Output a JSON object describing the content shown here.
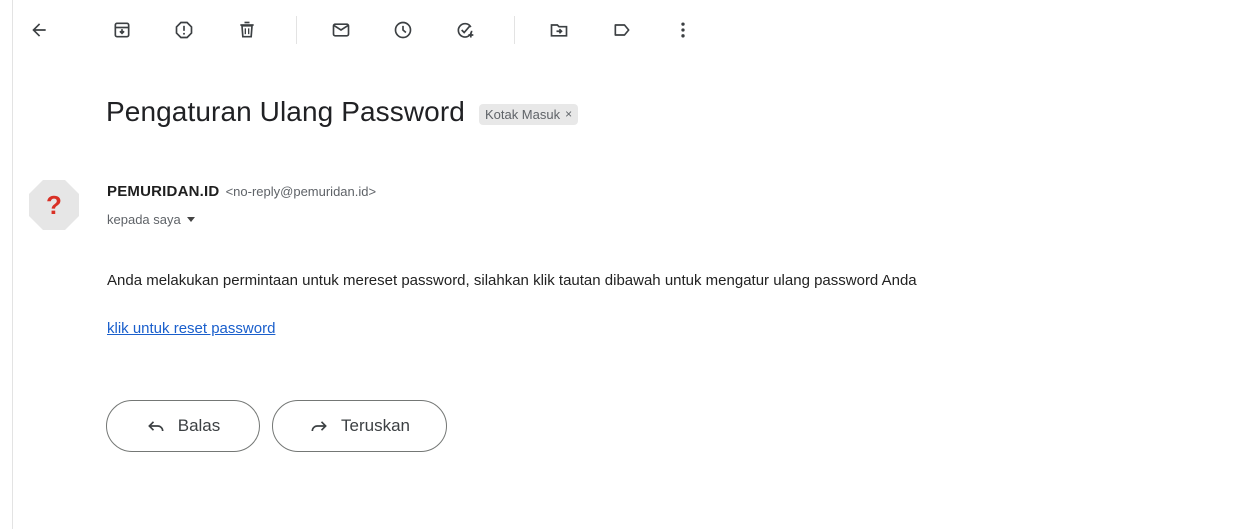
{
  "toolbar": {
    "buttons": [
      {
        "icon": "back-arrow-icon"
      },
      {
        "icon": "archive-icon"
      },
      {
        "icon": "report-spam-icon"
      },
      {
        "icon": "delete-icon"
      },
      {
        "icon": "mark-unread-icon"
      },
      {
        "icon": "snooze-icon"
      },
      {
        "icon": "add-task-icon"
      },
      {
        "icon": "move-to-icon"
      },
      {
        "icon": "label-icon"
      },
      {
        "icon": "more-vert-icon"
      }
    ]
  },
  "email": {
    "subject": "Pengaturan Ulang Password",
    "label_chip": "Kotak Masuk",
    "label_remove": "×",
    "sender_name": "PEMURIDAN.ID",
    "sender_email": "<no-reply@pemuridan.id>",
    "recipient": "kepada saya",
    "avatar_glyph": "?",
    "body": "Anda melakukan permintaan untuk mereset password, silahkan klik tautan dibawah untuk mengatur ulang password Anda",
    "link_text": "klik untuk reset password"
  },
  "actions": {
    "reply_label": "Balas",
    "forward_label": "Teruskan"
  },
  "colors": {
    "link": "#1a5fcc",
    "avatar_bg": "#e6e6e6",
    "avatar_glyph": "#d93025",
    "chip_bg": "#e8e8e8"
  }
}
